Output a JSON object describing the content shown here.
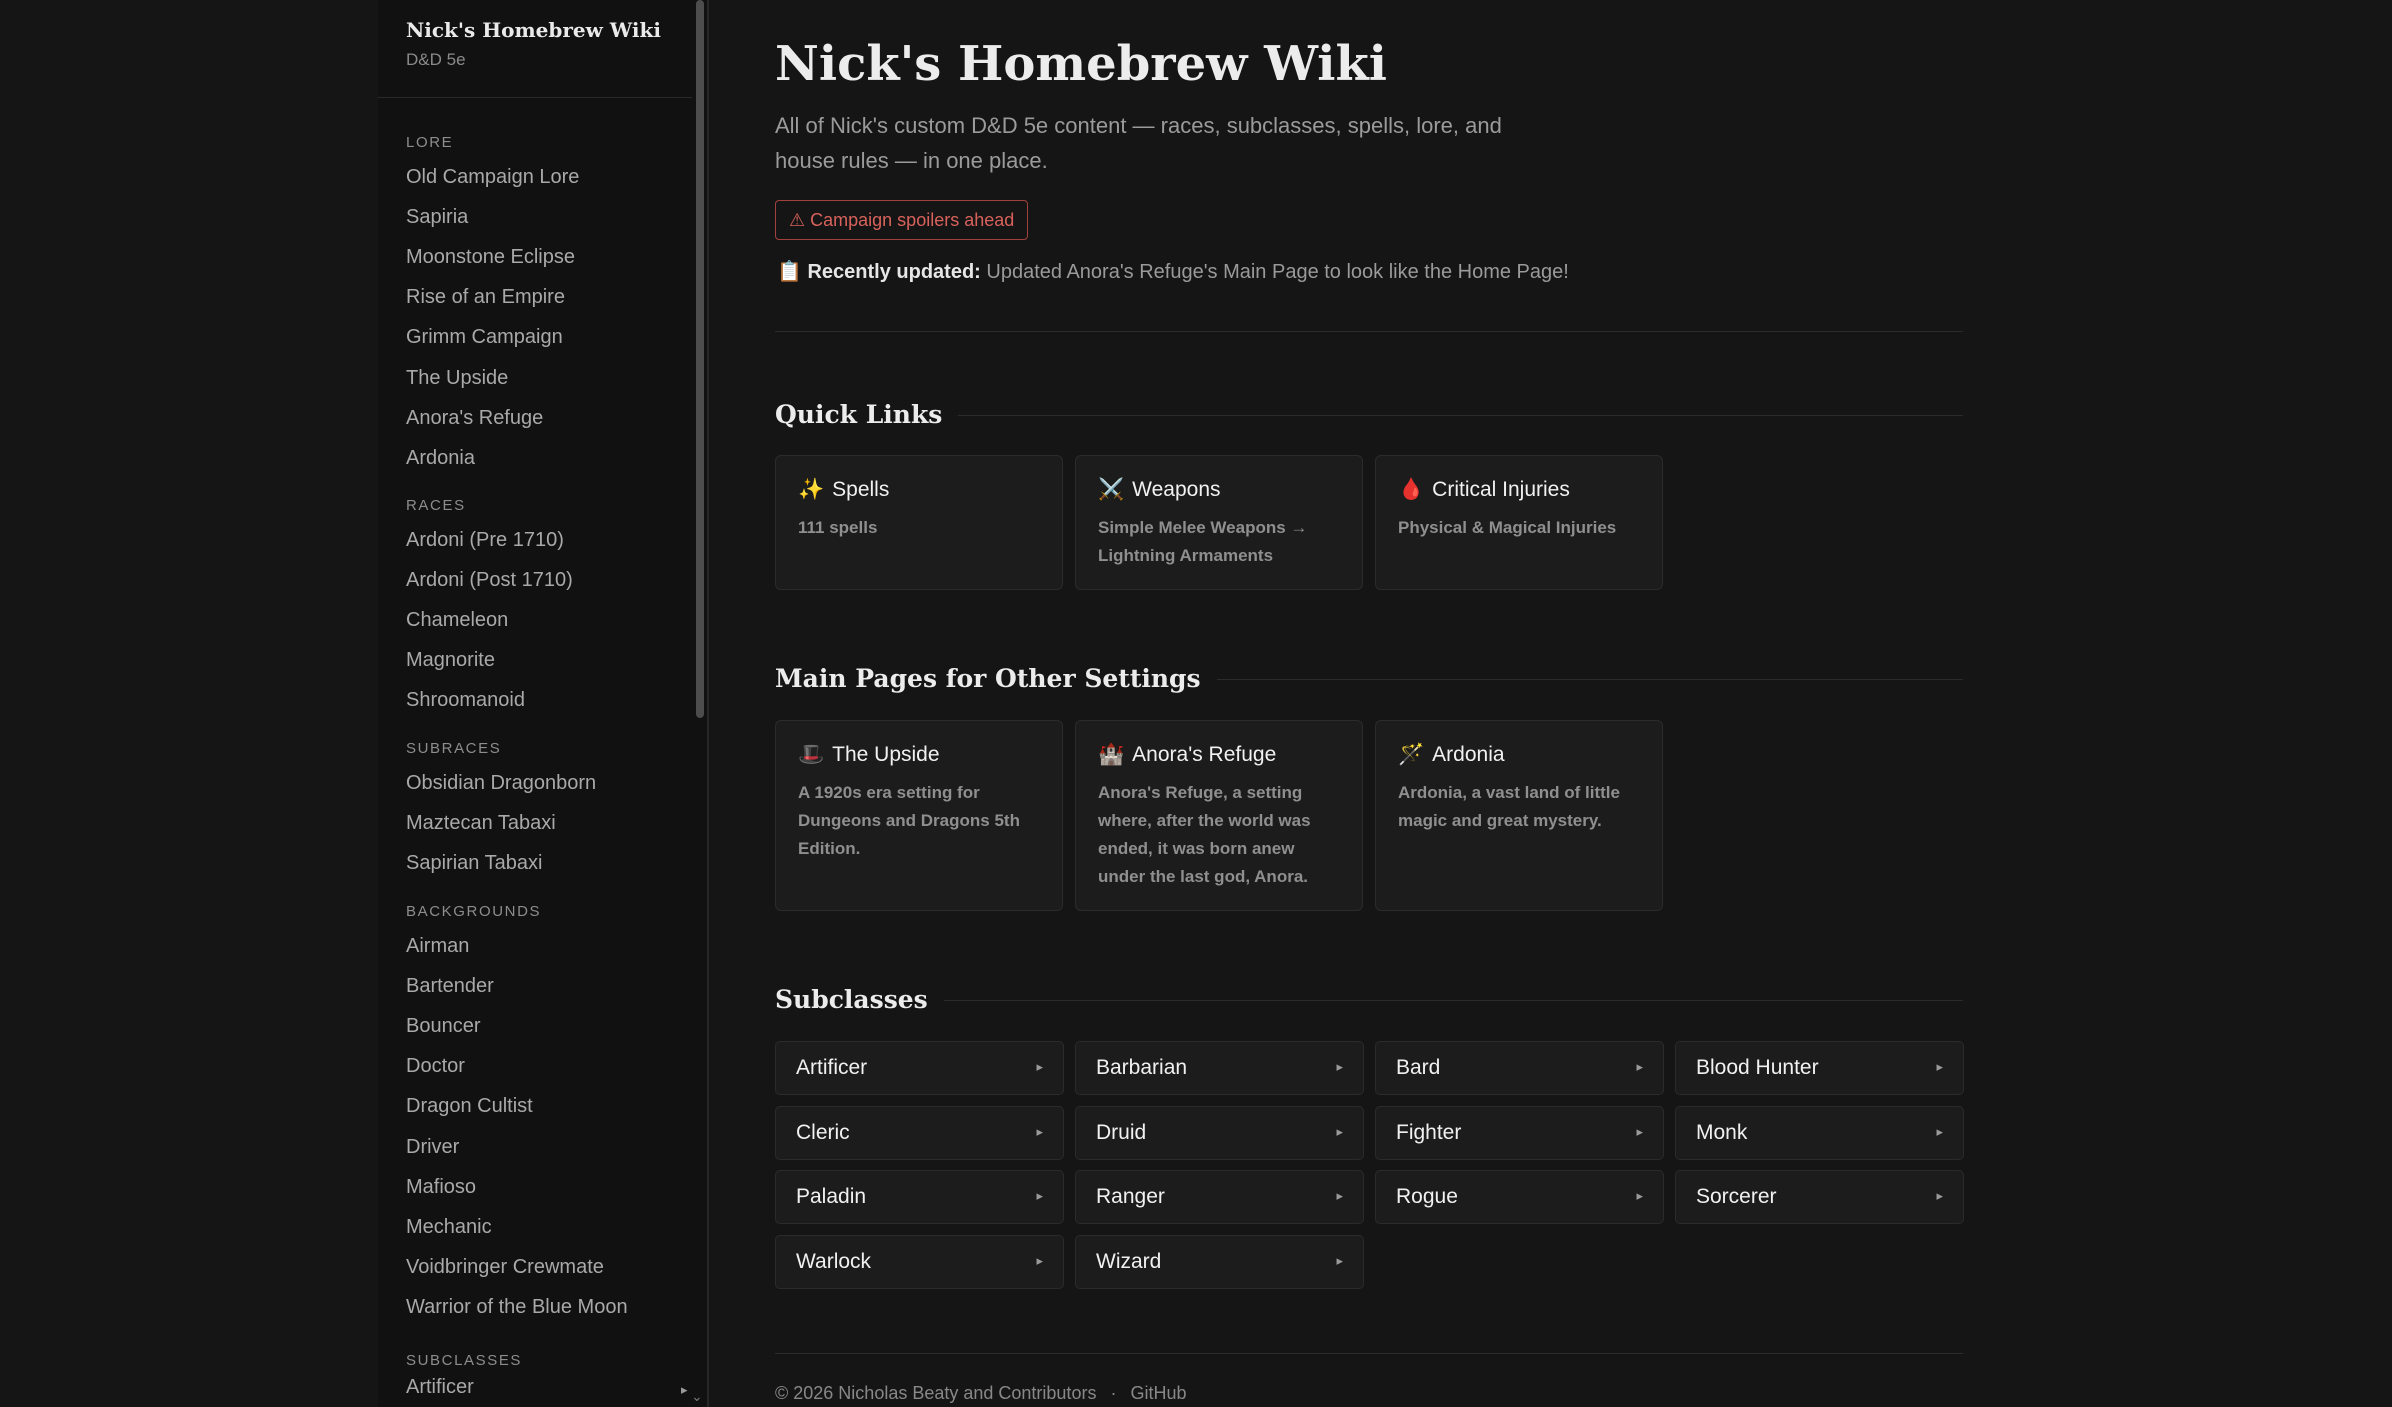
{
  "sidebar": {
    "title": "Nick's Homebrew Wiki",
    "subtitle": "D&D 5e",
    "groups": [
      {
        "heading": "Lore",
        "items": [
          "Old Campaign Lore",
          "Sapiria",
          "Moonstone Eclipse",
          "Rise of an Empire",
          "Grimm Campaign",
          "The Upside",
          "Anora's Refuge",
          "Ardonia"
        ]
      },
      {
        "heading": "Races",
        "items": [
          "Ardoni (Pre 1710)",
          "Ardoni (Post 1710)",
          "Chameleon",
          "Magnorite",
          "Shroomanoid"
        ]
      },
      {
        "heading": "Subraces",
        "items": [
          "Obsidian Dragonborn",
          "Maztecan Tabaxi",
          "Sapirian Tabaxi"
        ]
      },
      {
        "heading": "Backgrounds",
        "items": [
          "Airman",
          "Bartender",
          "Bouncer",
          "Doctor",
          "Dragon Cultist",
          "Driver",
          "Mafioso",
          "Mechanic",
          "Voidbringer Crewmate",
          "Warrior of the Blue Moon"
        ]
      },
      {
        "heading": "Subclasses",
        "items": [
          "Artificer"
        ]
      }
    ],
    "caret": "▸",
    "scroll_down": "⌄"
  },
  "main": {
    "title": "Nick's Homebrew Wiki",
    "intro": "All of Nick's custom D&D 5e content — races, subclasses, spells, lore, and house rules — in one place.",
    "spoiler": "⚠ Campaign spoilers ahead",
    "updated_icon": "📋",
    "updated_label": "Recently updated:",
    "updated_text": "Updated Anora's Refuge's Main Page to look like the Home Page!",
    "quick_links_title": "Quick Links",
    "quick_links": [
      {
        "icon": "✨",
        "icon_name": "sparkles-icon",
        "title": "Spells",
        "desc": "111 spells"
      },
      {
        "icon": "⚔️",
        "icon_name": "crossed-swords-icon",
        "title": "Weapons",
        "desc": "Simple Melee Weapons → Lightning Armaments"
      },
      {
        "icon": "🩸",
        "icon_name": "blood-drop-icon",
        "title": "Critical Injuries",
        "desc": "Physical & Magical Injuries"
      }
    ],
    "other_settings_title": "Main Pages for Other Settings",
    "other_settings": [
      {
        "icon": "🎩",
        "icon_name": "top-hat-icon",
        "title": "The Upside",
        "desc": "A 1920s era setting for Dungeons and Dragons 5th Edition."
      },
      {
        "icon": "🏰",
        "icon_name": "castle-icon",
        "title": "Anora's Refuge",
        "desc": "Anora's Refuge, a setting where, after the world was ended, it was born anew under the last god, Anora."
      },
      {
        "icon": "🪄",
        "icon_name": "magic-wand-icon",
        "title": "Ardonia",
        "desc": "Ardonia, a vast land of little magic and great mystery."
      }
    ],
    "subclasses_title": "Subclasses",
    "subclasses": [
      "Artificer",
      "Barbarian",
      "Bard",
      "Blood Hunter",
      "Cleric",
      "Druid",
      "Fighter",
      "Monk",
      "Paladin",
      "Ranger",
      "Rogue",
      "Sorcerer",
      "Warlock",
      "Wizard"
    ],
    "subclass_caret": "▸",
    "footer_copyright": "© 2026 Nicholas Beaty and Contributors",
    "footer_sep": "·",
    "footer_link": "GitHub"
  },
  "colors": {
    "background": "#151515",
    "sidebar": "#111111",
    "card": "#1c1c1c",
    "spoiler": "#d8625b"
  }
}
